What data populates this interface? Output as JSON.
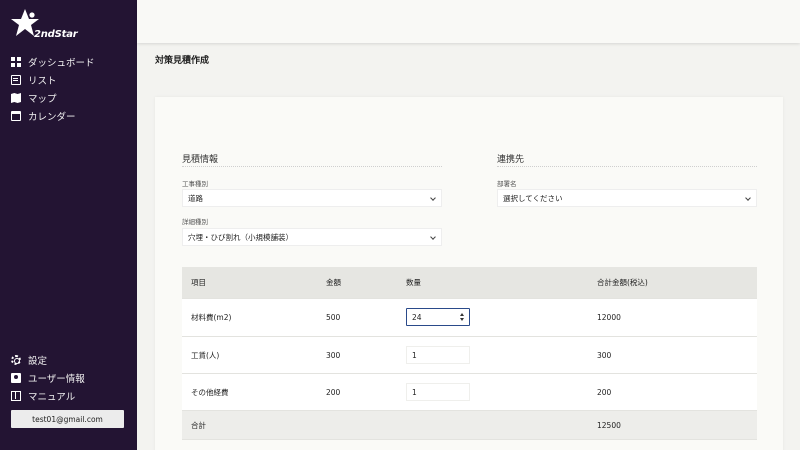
{
  "app": {
    "logo_text": "2ndStar"
  },
  "sidebar": {
    "top_items": [
      {
        "label": "ダッシュボード",
        "icon": "dashboard-icon"
      },
      {
        "label": "リスト",
        "icon": "list-icon"
      },
      {
        "label": "マップ",
        "icon": "map-icon"
      },
      {
        "label": "カレンダー",
        "icon": "calendar-icon"
      }
    ],
    "bottom_items": [
      {
        "label": "設定",
        "icon": "gear-icon"
      },
      {
        "label": "ユーザー情報",
        "icon": "user-icon"
      },
      {
        "label": "マニュアル",
        "icon": "book-icon"
      }
    ],
    "email": "test01@gmail.com"
  },
  "page": {
    "title": "対策見積作成"
  },
  "estimate": {
    "section_title": "見積情報",
    "work_type": {
      "label": "工事種別",
      "value": "道路"
    },
    "detail_type": {
      "label": "詳細種別",
      "value": "穴埋・ひび割れ（小規模舗装）"
    }
  },
  "contact": {
    "section_title": "連携先",
    "department": {
      "label": "部署名",
      "value": "選択してください"
    }
  },
  "table": {
    "headers": [
      "項目",
      "金額",
      "数量",
      "合計金額(税込)"
    ],
    "rows": [
      {
        "item": "材料費(m2)",
        "price": "500",
        "qty": "24",
        "total": "12000"
      },
      {
        "item": "工賃(人)",
        "price": "300",
        "qty": "1",
        "total": "300"
      },
      {
        "item": "その他経費",
        "price": "200",
        "qty": "1",
        "total": "200"
      }
    ],
    "total_label": "合計",
    "total_value": "12500"
  },
  "colors": {
    "sidebar_bg": "#231433",
    "focus_border": "#2a4a8a"
  }
}
